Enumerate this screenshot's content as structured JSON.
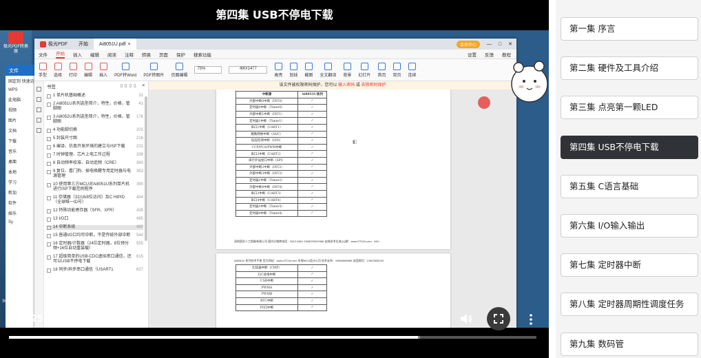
{
  "video": {
    "title": "第四集 USB不停电下载",
    "current_time": "25:58",
    "duration": "33:31",
    "time_display": "25:58 / 33:31",
    "progress_fraction": 0.775,
    "buffered_fraction": 0.78
  },
  "desktop": {
    "icons": [
      {
        "label": "极光PDF转换器",
        "color": "#e53935"
      },
      {
        "label": "应用",
        "color": "#d32f2f"
      },
      {
        "label": "WPS",
        "color": "#2e7d32"
      },
      {
        "label": "此电脑",
        "color": "#90a4ae"
      },
      {
        "label": "网",
        "color": "#1976d2"
      },
      {
        "label": "Syn",
        "color": "#1565c0"
      },
      {
        "label": "SOL 13 小项目 2020",
        "color": "#f9a825"
      }
    ]
  },
  "explorer": {
    "title": "文件",
    "items": [
      "固定到 快速访问",
      "WPS",
      "此电脑",
      "视频",
      "图片",
      "文档",
      "下载",
      "音乐",
      "桌面",
      "本地",
      "学习",
      "新加",
      "软件",
      "娱乐",
      "Sy"
    ]
  },
  "pdf_app": {
    "tabs": [
      {
        "label": "极光PDF",
        "active": true
      },
      {
        "label": "开始",
        "active": false
      },
      {
        "label": "Ai8051U.pdf",
        "active": true
      }
    ],
    "vip_label": "会员中心",
    "menu": [
      "文件",
      "开始",
      "插入",
      "编辑",
      "阅读",
      "注释",
      "转换",
      "页面",
      "保护",
      "搜索功能"
    ],
    "menu_active": "开始",
    "menu_right": [
      "设置",
      "反馈",
      "教程"
    ],
    "toolbar": {
      "items": [
        "手型",
        "选择",
        "打印",
        "编辑",
        "插入",
        "PDF转Word",
        "PDF转图片",
        "页面编辑"
      ],
      "zoom": "75%",
      "page": "490/1477",
      "right_items": [
        "高亮",
        "划线",
        "截图",
        "全文翻译",
        "背景",
        "幻灯片",
        "首页",
        "双页",
        "连续"
      ]
    },
    "notice": {
      "text": "该文件被权限密码保护，您可以",
      "link1": "输入密码",
      "sep": "或",
      "link2": "去除密码保护"
    },
    "bookmarks": {
      "title": "书签",
      "items": [
        {
          "text": "1 单片机基础概述",
          "page": "31"
        },
        {
          "text": "2 Ai8051U系列选型简介，特性，价格，管脚图",
          "page": "41"
        },
        {
          "text": "3 Ai8052U系列选型简介，特性，价格，管脚图",
          "page": "176"
        },
        {
          "text": "4 功能脚切换",
          "page": "202"
        },
        {
          "text": "5 封装尺寸图",
          "page": "216"
        },
        {
          "text": "6 编译、仿真开发环境的建立与ISP下载",
          "page": "231"
        },
        {
          "text": "7 时钟管理、芯片上电工作过程",
          "page": "336"
        },
        {
          "text": "8 自动频率校准、自动追频（CRE）",
          "page": "360"
        },
        {
          "text": "9 复位、看门狗、掉电唤醒专用定时器与电源管理",
          "page": "363"
        },
        {
          "text": "10 使用第三方MCU对Ai8051U系列单片机进行ISP下载范例程序",
          "page": "390"
        },
        {
          "text": "11 存储器（32/16/8位访问）及C HIPID（全球唯一ID号）",
          "page": "404"
        },
        {
          "text": "12 特殊功能寄存器（SFR、XFR）",
          "page": "435"
        },
        {
          "text": "13 I/O口",
          "page": "465"
        },
        {
          "text": "14 中断系统",
          "page": "490",
          "selected": true
        },
        {
          "text": "15 普通I/O口均可中断，不是传统外部中断",
          "page": "544"
        },
        {
          "text": "16 定时器/计数器（24位定时器，8位预分频+16位自动重装载）",
          "page": "555"
        },
        {
          "text": "17 超级简单的USB-CDC虚拟串口通信，还可以USB不停电下载",
          "page": "615"
        },
        {
          "text": "18 同步/异步串口通信（USART1",
          "page": "627"
        }
      ]
    },
    "table_page1": {
      "header": [
        "中断源",
        "Ai8051U系列"
      ],
      "rows": [
        [
          "外部中断0中断（INT0）",
          "✓"
        ],
        [
          "定时器0中断（Timer0）",
          "✓"
        ],
        [
          "外部中断1中断（INT1）",
          "✓"
        ],
        [
          "定时器1中断（Timer1）",
          "✓"
        ],
        [
          "串口1中断（UART1）",
          "✓"
        ],
        [
          "模数转换中断（ADC）",
          "✓"
        ],
        [
          "低压检测中断（LVD）",
          "✓"
        ],
        [
          "CCP/PCA/PWM中断",
          "✓"
        ],
        [
          "串口2中断（UART2）",
          "✓"
        ],
        [
          "串行外设接口中断（SPI）",
          "✓"
        ],
        [
          "外部中断2中断（INT2）",
          "✓"
        ],
        [
          "外部中断3中断（INT3）",
          "✓"
        ],
        [
          "定时器2中断（Timer2）",
          "✓"
        ],
        [
          "外部中断4中断（INT4）",
          "✓"
        ],
        [
          "串口3中断（UART3）",
          "✓"
        ],
        [
          "串口4中断（UART4）",
          "✓"
        ],
        [
          "定时器3中断（Timer3）",
          "✓"
        ],
        [
          "定时器4中断（Timer4）",
          "✓"
        ]
      ],
      "footer": "深圳国芯人工智能有限公司  国内分销商电话：0513-5501 2928/2929/2966  去纯技术交流QQ群：www.STCAI.com  - 490 -"
    },
    "table_page2": {
      "header": "Ai8051U 系列技术手册  官方网站：www.STCAI.com  车规MCU设计公司  技术支持：19864585985  选型顾问：13922805190",
      "rows": [
        [
          "比较器中断（CMP）",
          "✓"
        ],
        [
          "I2C总线中断",
          "✓"
        ],
        [
          "USB中断",
          "✓"
        ],
        [
          "PWMA",
          "✓"
        ],
        [
          "PWMB",
          "✓"
        ],
        [
          "RTC中断",
          "✓"
        ],
        [
          "P0口中断",
          "✓"
        ]
      ]
    }
  },
  "episodes": [
    {
      "label": "第一集 序言",
      "active": false
    },
    {
      "label": "第二集 硬件及工具介绍",
      "active": false
    },
    {
      "label": "第三集 点亮第一颗LED",
      "active": false
    },
    {
      "label": "第四集 USB不停电下载",
      "active": true
    },
    {
      "label": "第五集 C语言基础",
      "active": false
    },
    {
      "label": "第六集 I/O输入输出",
      "active": false
    },
    {
      "label": "第七集 定时器中断",
      "active": false
    },
    {
      "label": "第八集 定时器周期性调度任务",
      "active": false
    },
    {
      "label": "第九集 数码管",
      "active": false
    }
  ],
  "colors": {
    "active_episode_bg": "#2f3237",
    "accent_red": "#e53935",
    "progress_played": "#ffffff",
    "progress_track": "#555555"
  },
  "icons": [
    "play-icon",
    "volume-icon",
    "fullscreen-icon",
    "more-vert-icon"
  ]
}
